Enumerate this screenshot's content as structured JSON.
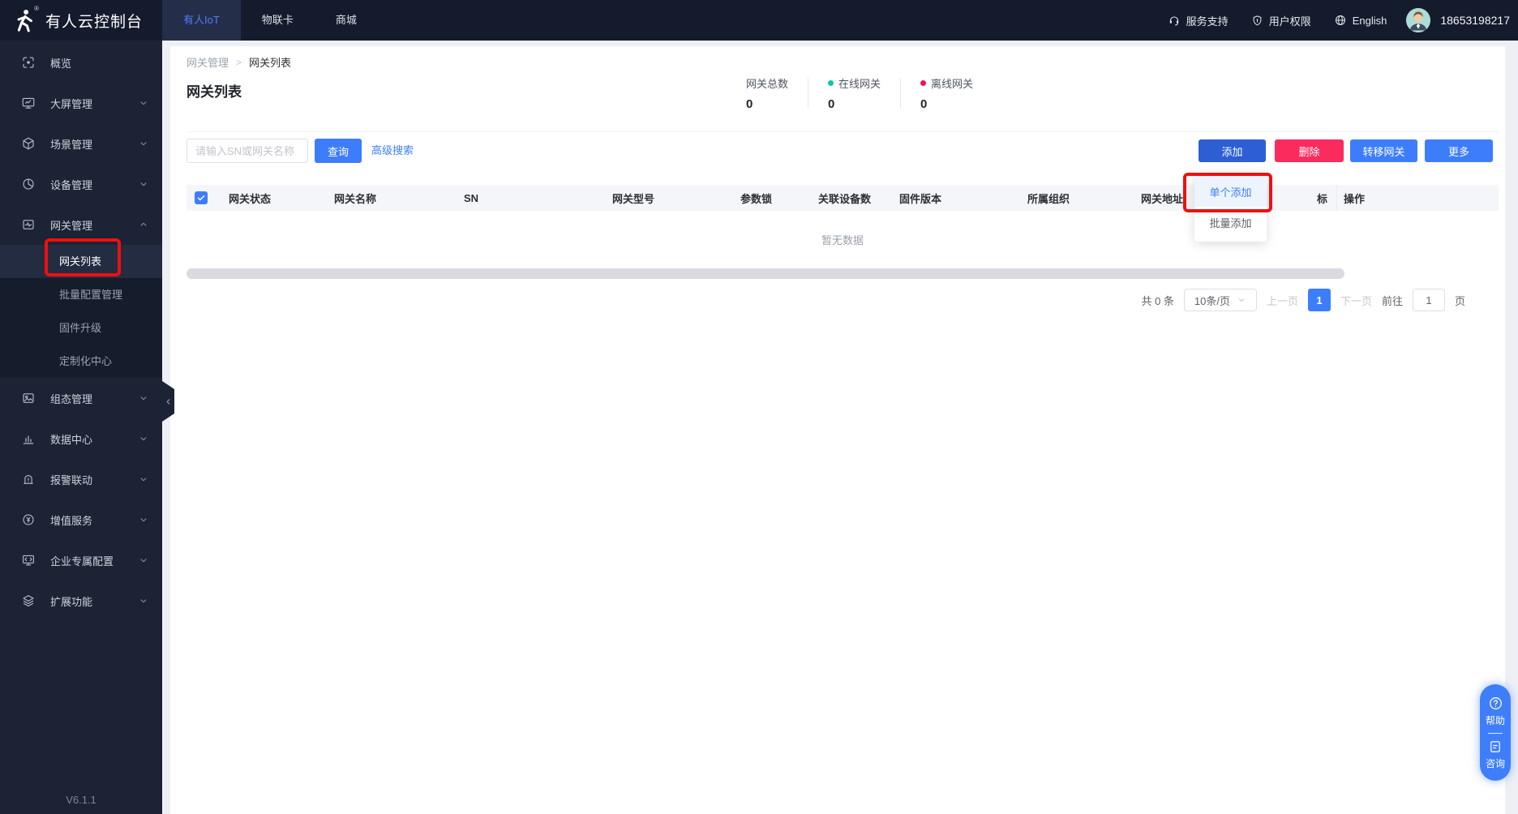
{
  "brand": {
    "name": "有人云控制台",
    "registered": "®"
  },
  "topnav": {
    "tabs": [
      {
        "label": "有人IoT",
        "active": true
      },
      {
        "label": "物联卡",
        "active": false
      },
      {
        "label": "商城",
        "active": false
      }
    ]
  },
  "topright": {
    "support": "服务支持",
    "permission": "用户权限",
    "language": "English",
    "phone": "18653198217"
  },
  "sidebar": {
    "items": [
      {
        "label": "概览"
      },
      {
        "label": "大屏管理"
      },
      {
        "label": "场景管理"
      },
      {
        "label": "设备管理"
      },
      {
        "label": "网关管理"
      },
      {
        "label": "组态管理"
      },
      {
        "label": "数据中心"
      },
      {
        "label": "报警联动"
      },
      {
        "label": "增值服务"
      },
      {
        "label": "企业专属配置"
      },
      {
        "label": "扩展功能"
      }
    ],
    "gateway_submenu": [
      {
        "label": "网关列表",
        "active": true
      },
      {
        "label": "批量配置管理",
        "active": false
      },
      {
        "label": "固件升级",
        "active": false
      },
      {
        "label": "定制化中心",
        "active": false
      }
    ],
    "version": "V6.1.1"
  },
  "breadcrumb": {
    "parent": "网关管理",
    "separator": ">",
    "current": "网关列表"
  },
  "page": {
    "title": "网关列表"
  },
  "stats": {
    "total": {
      "label": "网关总数",
      "value": "0"
    },
    "online": {
      "label": "在线网关",
      "value": "0",
      "color": "#0bc9a2"
    },
    "offline": {
      "label": "离线网关",
      "value": "0",
      "color": "#ec135f"
    }
  },
  "toolbar": {
    "search_placeholder": "请输入SN或网关名称",
    "query": "查询",
    "advanced_search": "高级搜索",
    "add": "添加",
    "delete": "删除",
    "transfer": "转移网关",
    "more": "更多"
  },
  "table": {
    "headers": [
      "网关状态",
      "网关名称",
      "SN",
      "网关型号",
      "参数锁",
      "关联设备数",
      "固件版本",
      "所属组织",
      "网关地址",
      "标",
      "操作"
    ],
    "empty_text": "暂无数据"
  },
  "add_dropdown": {
    "items": [
      {
        "label": "单个添加",
        "active": true
      },
      {
        "label": "批量添加",
        "active": false
      }
    ]
  },
  "pagination": {
    "total": "共 0 条",
    "page_size": "10条/页",
    "prev": "上一页",
    "current_page": "1",
    "next": "下一页",
    "goto_label": "前往",
    "goto_value": "1",
    "page_unit": "页"
  },
  "float_widget": {
    "help": "帮助",
    "consult": "咨询"
  },
  "colors": {
    "primary": "#3d7dfb",
    "add_button": "#2d5ed3",
    "delete_button": "#fb2b5e",
    "online_dot": "#0bc9a2",
    "offline_dot": "#ec135f",
    "annotation_red": "#ee1010",
    "topbar_bg": "#141b2d",
    "sidebar_bg": "#1b2334"
  }
}
